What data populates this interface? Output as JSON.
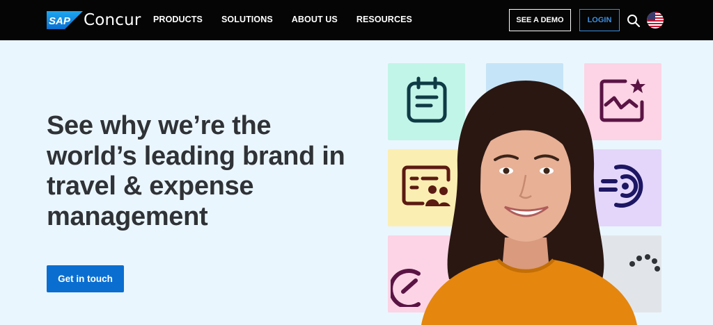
{
  "header": {
    "logo_badge": "SAP",
    "brand": "Concur",
    "nav": [
      "PRODUCTS",
      "SOLUTIONS",
      "ABOUT US",
      "RESOURCES"
    ],
    "demo_label": "SEE A DEMO",
    "login_label": "LOGIN",
    "icons": [
      "search-icon",
      "us-flag-icon"
    ]
  },
  "hero": {
    "headline": "See why we’re the world’s leading brand in travel & expense management",
    "cta_label": "Get in touch"
  },
  "tiles": [
    {
      "icon": "calendar-icon",
      "color": "#c1f5e8"
    },
    {
      "icon": "star-icon",
      "color": "#c6e4f8"
    },
    {
      "icon": "chart-star-icon",
      "color": "#fcd4e5"
    },
    {
      "icon": "team-presentation-icon",
      "color": "#fbeeb2"
    },
    {
      "icon": "speed-target-icon",
      "color": "#e3d6fa"
    },
    {
      "icon": "circle-arrow-icon",
      "color": "#fcd4e5"
    },
    {
      "icon": "dots-icon",
      "color": "#e1e5ea"
    }
  ],
  "colors": {
    "header_bg": "#050505",
    "hero_bg": "#eaf6fd",
    "headline": "#2f3236",
    "cta": "#0a6ed1",
    "login": "#3d8fe0"
  }
}
